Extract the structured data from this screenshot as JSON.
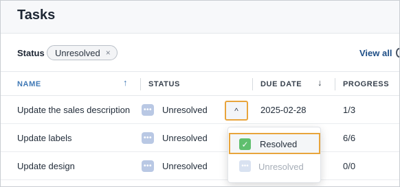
{
  "page": {
    "title": "Tasks"
  },
  "filter": {
    "label": "Status",
    "chip_value": "Unresolved",
    "chip_remove_icon": "×",
    "view_all": "View all"
  },
  "table": {
    "columns": {
      "name": "NAME",
      "status": "STATUS",
      "due_date": "DUE DATE",
      "progress": "PROGRESS"
    },
    "sort_icons": {
      "name": "↑",
      "due_date": "↓"
    },
    "rows": [
      {
        "name": "Update the sales description",
        "status": "Unresolved",
        "due_date": "2025-02-28",
        "progress": "1/3"
      },
      {
        "name": "Update labels",
        "status": "Unresolved",
        "due_date": "",
        "progress": "6/6"
      },
      {
        "name": "Update design",
        "status": "Unresolved",
        "due_date": "",
        "progress": "0/0"
      }
    ],
    "status_icon_glyph": "•••"
  },
  "status_dropdown": {
    "toggle_glyph": "^",
    "options": [
      {
        "label": "Resolved",
        "icon": "check-icon",
        "glyph": "✓",
        "state": "highlighted"
      },
      {
        "label": "Unresolved",
        "icon": "dots-icon",
        "glyph": "•••",
        "state": "disabled"
      }
    ]
  },
  "colors": {
    "accent": "#e8a43b",
    "link": "#1e4e86",
    "header_sorted": "#3f78b5",
    "resolved_green": "#5fbf6e",
    "unresolved_blue": "#b9c8e4"
  }
}
